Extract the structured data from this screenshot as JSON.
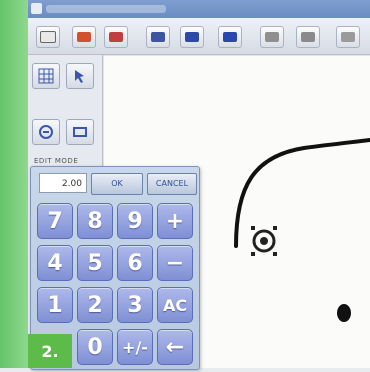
{
  "step": {
    "label": "2."
  },
  "keypad": {
    "display_value": "2.00",
    "ok_label": "OK",
    "cancel_label": "CANCEL",
    "keys": [
      [
        "7",
        "8",
        "9",
        "+"
      ],
      [
        "4",
        "5",
        "6",
        "−"
      ],
      [
        "1",
        "2",
        "3",
        "AC"
      ],
      [
        "0",
        "+/-",
        "←"
      ]
    ]
  },
  "side_panel": {
    "label": "EDIT MODE"
  },
  "toolbar": {
    "icons": [
      "open-file-icon",
      "color-icon",
      "paint-icon",
      "thread-icon",
      "view-icon",
      "layout-icon",
      "rotate-icon",
      "mirror-icon",
      "arrow-icon"
    ]
  }
}
